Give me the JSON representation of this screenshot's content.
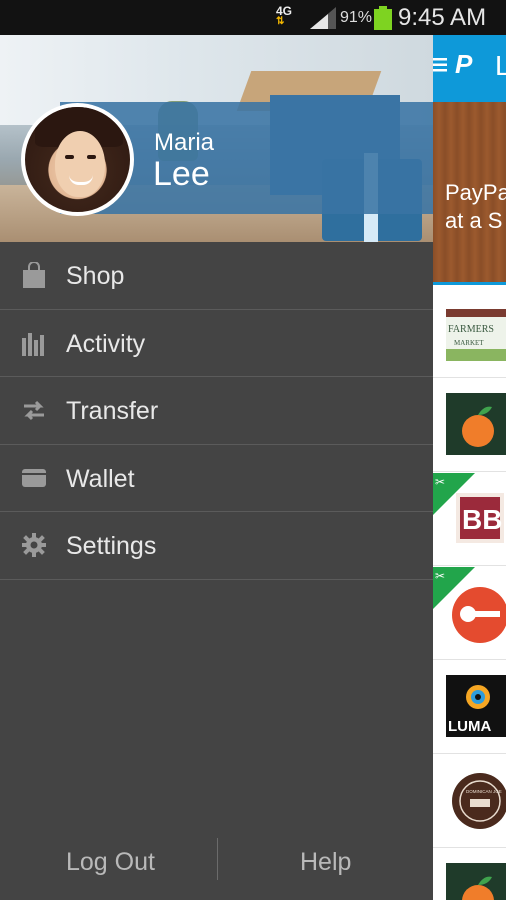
{
  "status_bar": {
    "network": "4G",
    "battery_percent": "91%",
    "time": "9:45 AM",
    "battery_color": "#7ed321"
  },
  "user": {
    "first_name": "Maria",
    "last_name": "Lee"
  },
  "menu": {
    "items": [
      {
        "label": "Shop",
        "icon": "shopping-bag-icon"
      },
      {
        "label": "Activity",
        "icon": "bar-chart-icon"
      },
      {
        "label": "Transfer",
        "icon": "transfer-arrows-icon"
      },
      {
        "label": "Wallet",
        "icon": "wallet-icon"
      },
      {
        "label": "Settings",
        "icon": "gear-icon"
      }
    ]
  },
  "footer": {
    "logout_label": "Log Out",
    "help_label": "Help"
  },
  "background_app": {
    "header_title_partial": "L",
    "promo_line1": "PayPa",
    "promo_line2": "at a S",
    "merchants": [
      {
        "name": "FARMERS MARKET",
        "line1": "FARMERS",
        "line2": "MARKET"
      },
      {
        "name": "orange-logo"
      },
      {
        "name": "BB",
        "label": "BB",
        "ribbon": true
      },
      {
        "name": "guitar-logo",
        "ribbon": true
      },
      {
        "name": "LUMA",
        "label": "LUMA"
      },
      {
        "name": "DOMINICAN JOE",
        "label": "DOMINICAN JOE"
      },
      {
        "name": "orange-logo"
      }
    ],
    "accent_color": "#0e99d9"
  }
}
